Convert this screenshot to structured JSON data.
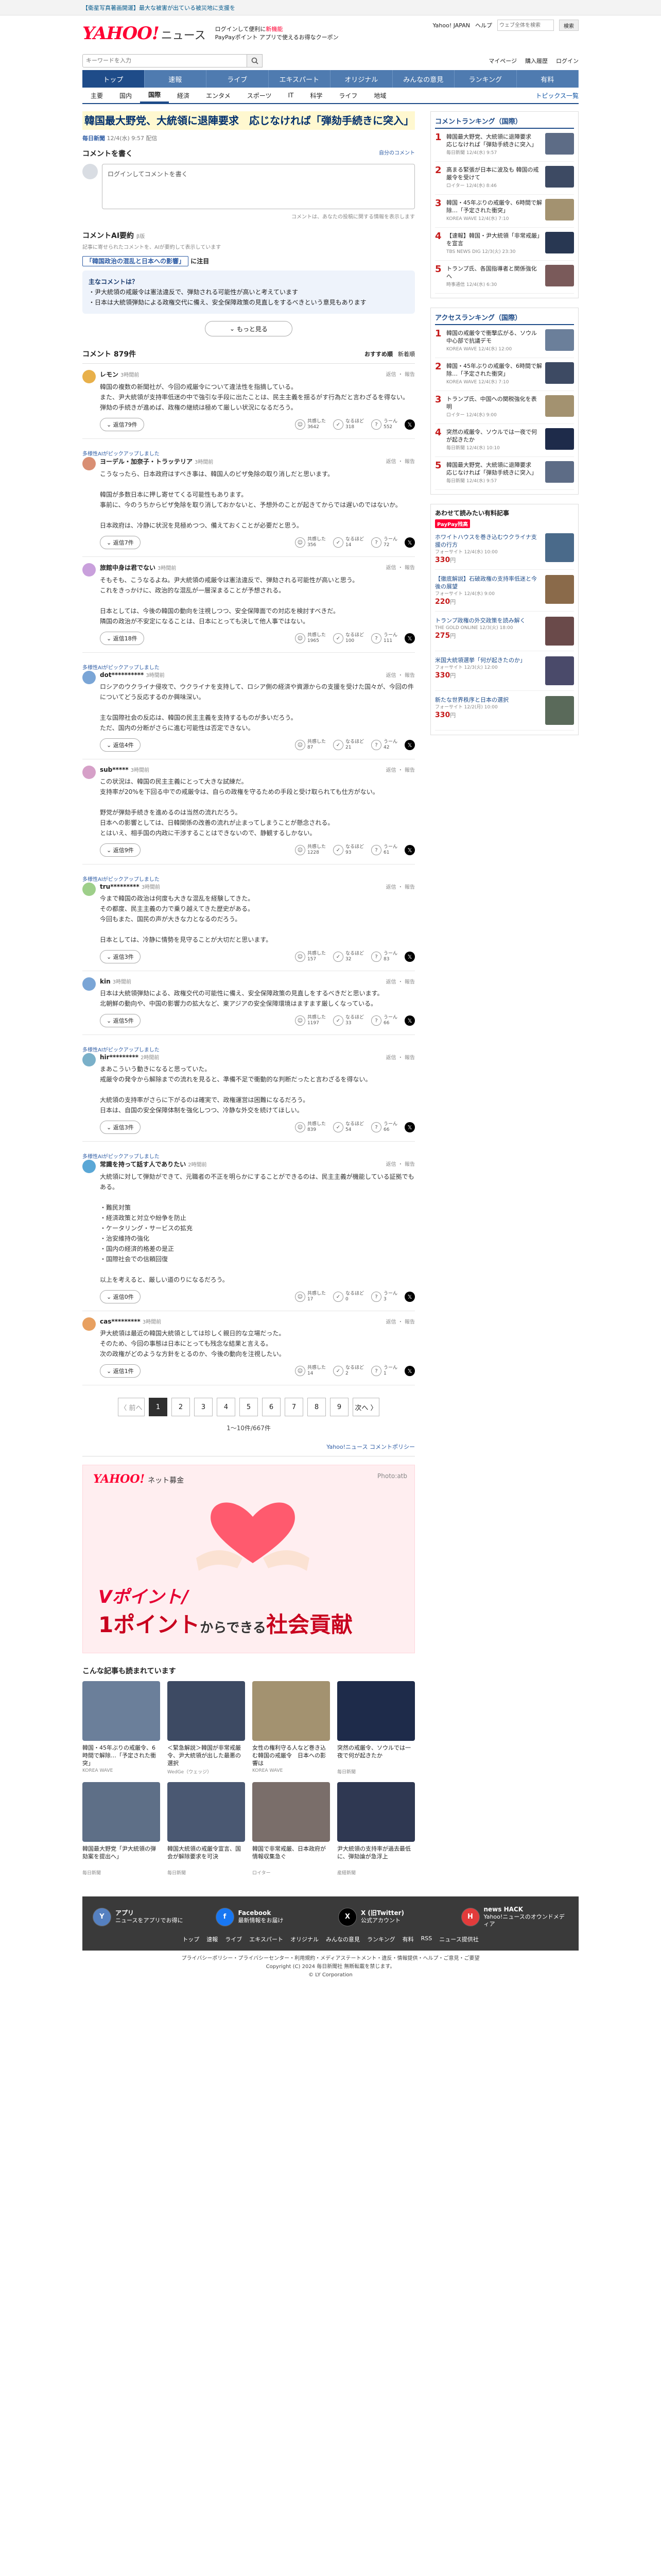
{
  "topnotice": {
    "tag": "【衛星写真著画開運】最大な被害が出ている被災地に支援を",
    "right": "Yahoo! JAPAN"
  },
  "masthead": {
    "brand": "YAHOO!",
    "brand_sub": "ニュース",
    "promo1": "ログインして便利に",
    "promo1_red": "新機能",
    "promo2": "PayPayポイント",
    "promo2b": "アプリで使えるお得なクーポン",
    "links": [
      "Yahoo! JAPAN",
      "ヘルプ"
    ],
    "search_placeholder": "ウェブ全体を検索",
    "search_button": "検索"
  },
  "searchbar": {
    "placeholder": "キーワードを入力",
    "links": [
      "マイページ",
      "購入履歴",
      "ログイン"
    ]
  },
  "gnav": [
    "トップ",
    "速報",
    "ライブ",
    "エキスパート",
    "オリジナル",
    "みんなの意見",
    "ランキング",
    "有料"
  ],
  "subnav": {
    "items": [
      "主要",
      "国内",
      "国際",
      "経済",
      "エンタメ",
      "スポーツ",
      "IT",
      "科学",
      "ライフ",
      "地域"
    ],
    "right": "トピックス一覧"
  },
  "article": {
    "title": "韓国最大野党、大統領に退陣要求　応じなければ「弾劾手続きに突入」",
    "source": "毎日新聞",
    "time": "12/4(水) 9:57 配信"
  },
  "write": {
    "heading": "コメントを書く",
    "right": "自分のコメント",
    "placeholder": "ログインしてコメントを書く",
    "note": "コメントは、あなたの投稿に関する情報を表示します"
  },
  "ai": {
    "heading": "コメントAI要約",
    "badge": "β版",
    "desc": "記事に寄せられたコメントを、AIが要約して表示しています",
    "topic_prefix": "「韓国政治の混乱と日本への影響」",
    "topic_suffix": "に注目",
    "box_head": "主なコメントは？",
    "points": [
      "尹大統領の戒厳令は憲法違反で、弾劾される可能性が高いと考えています",
      "日本は大統領弾劾による政権交代に備え、安全保障政策の見直しをするべきという意見もあります"
    ],
    "more": "もっと見る"
  },
  "comments": {
    "heading": "コメント",
    "count": "879件",
    "sort": [
      "おすすめ順",
      "新着順"
    ],
    "ai_pick": "多様性AIがピックアップしました",
    "reply_label": "返信",
    "report_label": "報告",
    "vote_labels": [
      "共感した",
      "なるほど",
      "うーん"
    ],
    "list": [
      {
        "name": "レモン",
        "time": "3時間前",
        "text": "韓国の複数の新聞社が、今回の戒厳令について違法性を指摘している。\nまた、尹大統領が支持率低迷の中で強引な手段に出たことは、民主主義を揺るがす行為だと言わざるを得ない。\n弾劾の手続きが進めば、政権の継続は極めて厳しい状況になるだろう。",
        "replies": "返信79件",
        "v": [
          "3642",
          "318",
          "552"
        ],
        "color": "#e8b04a",
        "ai": false
      },
      {
        "name": "ヨーデル・加奈子・トラッテリア",
        "time": "3時間前",
        "text": "こうなったら、日本政府はすべき事は、韓国人のビザ免除の取り消しだと思います。\n\n韓国が多数日本に押し寄せてくる可能性もあります。\n事前に、今のうちからビザ免除を取り消しておかないと、予想外のことが起きてからでは遅いのではないか。\n\n日本政府は、冷静に状況を見極めつつ、備えておくことが必要だと思う。",
        "replies": "返信7件",
        "v": [
          "356",
          "14",
          "72"
        ],
        "color": "#d98f74",
        "ai": true
      },
      {
        "name": "旅館中身は君でない",
        "time": "3時間前",
        "text": "そもそも、こうなるよね。尹大統領の戒厳令は憲法違反で、弾劾される可能性が高いと思う。\nこれをきっかけに、政治的な混乱が一層深まることが予想される。\n\n日本としては、今後の韓国の動向を注視しつつ、安全保障面での対応を検討すべきだ。\n隣国の政治が不安定になることは、日本にとっても決して他人事ではない。",
        "replies": "返信18件",
        "v": [
          "1965",
          "100",
          "111"
        ],
        "color": "#c9a0dc",
        "ai": false
      },
      {
        "name": "dot**********",
        "time": "3時間前",
        "text": "ロシアのウクライナ侵攻で、ウクライナを支持して、ロシア側の経済や資源からの支援を受けた国々が、今回の件についてどう反応するのか興味深い。\n\n主な国際社会の反応は、韓国の民主主義を支持するものが多いだろう。\nただ、国内の分断がさらに進む可能性は否定できない。",
        "replies": "返信4件",
        "v": [
          "87",
          "21",
          "42"
        ],
        "color": "#7aa5d6",
        "ai": true
      },
      {
        "name": "sub*****",
        "time": "3時間前",
        "text": "この状況は、韓国の民主主義にとって大きな試練だ。\n支持率が20%を下回る中での戒厳令は、自らの政権を守るための手段と受け取られても仕方がない。\n\n野党が弾劾手続きを進めるのは当然の流れだろう。\n日本への影響としては、日韓関係の改善の流れが止まってしまうことが懸念される。\nとはいえ、相手国の内政に干渉することはできないので、静観するしかない。",
        "replies": "返信9件",
        "v": [
          "1228",
          "93",
          "61"
        ],
        "color": "#d6a0c8",
        "ai": false
      },
      {
        "name": "tru*********",
        "time": "3時間前",
        "text": "今まで韓国の政治は何度も大きな混乱を経験してきた。\nその都度、民主主義の力で乗り越えてきた歴史がある。\n今回もまた、国民の声が大きな力となるのだろう。\n\n日本としては、冷静に情勢を見守ることが大切だと思います。",
        "replies": "返信3件",
        "v": [
          "157",
          "32",
          "83"
        ],
        "color": "#9ecf8a",
        "ai": true
      },
      {
        "name": "kin",
        "time": "3時間前",
        "text": "日本は大統領弾劾による、政権交代の可能性に備え、安全保障政策の見直しをするべきだと思います。\n北朝鮮の動向や、中国の影響力の拡大など、東アジアの安全保障環境はますます厳しくなっている。",
        "replies": "返信5件",
        "v": [
          "1197",
          "33",
          "66"
        ],
        "color": "#7aa5d6",
        "ai": false
      },
      {
        "name": "hir*********",
        "time": "2時間前",
        "text": "まあこういう動きになると思っていた。\n戒厳令の発令から解除までの流れを見ると、準備不足で衝動的な判断だったと言わざるを得ない。\n\n大統領の支持率がさらに下がるのは確実で、政権運営は困難になるだろう。\n日本は、自国の安全保障体制を強化しつつ、冷静な外交を続けてほしい。",
        "replies": "返信3件",
        "v": [
          "839",
          "54",
          "66"
        ],
        "color": "#7ab0c9",
        "ai": true
      },
      {
        "name": "常識を持って話す人でありたい",
        "time": "2時間前",
        "text": "大統領に対して弾劾ができて、元職者の不正を明らかにすることができるのは、民主主義が機能している証拠でもある。\n\n・難民対策\n・経済政策と対立や紛争を防止\n・ケータリング・サービスの拡充\n・治安維持の強化\n・国内の経済的格差の是正\n・国際社会での信頼回復\n\n以上を考えると、厳しい道のりになるだろう。",
        "replies": "返信0件",
        "v": [
          "17",
          "0",
          "3"
        ],
        "color": "#5aa7d6",
        "ai": true
      },
      {
        "name": "cas*********",
        "time": "3時間前",
        "text": "尹大統領は最近の韓国大統領としては珍しく親日的な立場だった。\nそのため、今回の事態は日本にとっても残念な結果と言える。\n次の政権がどのような方針をとるのか、今後の動向を注視したい。",
        "replies": "返信1件",
        "v": [
          "14",
          "2",
          "1"
        ],
        "color": "#e8a060",
        "ai": false
      }
    ]
  },
  "pager": {
    "prev": "〈 前へ",
    "next": "次へ 〉",
    "pages": [
      "1",
      "2",
      "3",
      "4",
      "5",
      "6",
      "7",
      "8",
      "9"
    ],
    "info": "1〜10件/667件",
    "link": "Yahoo!ニュース コメントポリシー"
  },
  "banner": {
    "brand": "YAHOO!",
    "brand_sub": "ネット募金",
    "right": "Photo:atb",
    "line1": "Vポイント/",
    "line2a": "1ポイント",
    "line2b": "からできる",
    "line2c": "社会貢献"
  },
  "related": {
    "heading": "こんな記事も読まれています",
    "cards": [
      {
        "t": "韓国・45年ぶりの戒厳令、6時間で解除…「予定された衝突」",
        "s": "KOREA WAVE",
        "c": "#6b7f9a"
      },
      {
        "t": "＜緊急解説＞韓国が非常戒厳令、尹大統領が出した最悪の選択",
        "s": "WedGe（ウェッジ）",
        "c": "#3d4a63"
      },
      {
        "t": "女性の権利守る人など巻き込む韓国の戒厳令　日本への影響は",
        "s": "KOREA WAVE",
        "c": "#a39270"
      },
      {
        "t": "突然の戒厳令、ソウルでは一夜で何が起きたか",
        "s": "毎日新聞",
        "c": "#1e2b4a"
      },
      {
        "t": "韓国最大野党「尹大統領の弾劾案を提出へ」",
        "s": "毎日新聞",
        "c": "#5e6f87"
      },
      {
        "t": "韓国大統領の戒厳令宣言、国会が解除要求を可決",
        "s": "毎日新聞",
        "c": "#4a5872"
      },
      {
        "t": "韓国で非常戒厳、日本政府が情報収集急ぐ",
        "s": "ロイター",
        "c": "#7a6e6a"
      },
      {
        "t": "尹大統領の支持率が過去最低に、弾劾論が急浮上",
        "s": "産経新聞",
        "c": "#2f3852"
      }
    ]
  },
  "side": {
    "rank_head": "コメントランキング（国際）",
    "ranks": [
      {
        "n": "1",
        "t": "韓国最大野党、大統領に退陣要求　応じなければ「弾劾手続きに突入」",
        "m": "毎日新聞 12/4(水) 9:57",
        "c": "#5d6c86"
      },
      {
        "n": "2",
        "t": "高まる緊張が日本に波及も 韓国の戒厳令を受けて",
        "m": "ロイター 12/4(水) 8:46",
        "c": "#3d4a63"
      },
      {
        "n": "3",
        "t": "韓国・45年ぶりの戒厳令、6時間で解除…「予定された衝突」",
        "m": "KOREA WAVE 12/4(水) 7:10",
        "c": "#a39270"
      },
      {
        "n": "4",
        "t": "【速報】韓国・尹大統領「非常戒厳」を宣言",
        "m": "TBS NEWS DIG 12/3(火) 23:30",
        "c": "#283752"
      },
      {
        "n": "5",
        "t": "トランプ氏、各国指導者と関係強化へ",
        "m": "時事通信 12/4(水) 6:30",
        "c": "#7a5a5a"
      }
    ],
    "access_head": "アクセスランキング（国際）",
    "access": [
      {
        "n": "1",
        "t": "韓国の戒厳令で衝撃広がる、ソウル中心部で抗議デモ",
        "m": "KOREA WAVE 12/4(水) 12:00",
        "c": "#6b7f9a"
      },
      {
        "n": "2",
        "t": "韓国・45年ぶりの戒厳令、6時間で解除…「予定された衝突」",
        "m": "KOREA WAVE 12/4(水) 7:10",
        "c": "#3d4a63"
      },
      {
        "n": "3",
        "t": "トランプ氏、中国への関税強化を表明",
        "m": "ロイター 12/4(水) 9:00",
        "c": "#a39270"
      },
      {
        "n": "4",
        "t": "突然の戒厳令、ソウルでは一夜で何が起きたか",
        "m": "毎日新聞 12/4(水) 10:10",
        "c": "#1e2b4a"
      },
      {
        "n": "5",
        "t": "韓国最大野党、大統領に退陣要求　応じなければ「弾劾手続きに突入」",
        "m": "毎日新聞 12/4(水) 9:57",
        "c": "#5d6c86"
      }
    ],
    "ads_head": "あわせて読みたい有料記事",
    "ads_pp": "PayPay残高",
    "ads": [
      {
        "t": "ホワイトハウスを巻き込むウクライナ支援の行方",
        "m": "フォーサイト 12/4(水) 10:00",
        "p": "330",
        "c": "#4a6a8a"
      },
      {
        "t": "【徹底解説】石破政権の支持率低迷と今後の展望",
        "m": "フォーサイト 12/4(水) 9:00",
        "p": "220",
        "c": "#8a6a4a"
      },
      {
        "t": "トランプ政権の外交政策を読み解く",
        "m": "THE GOLD ONLINE 12/3(火) 18:00",
        "p": "275",
        "c": "#6a4a4a"
      },
      {
        "t": "米国大統領選挙「何が起きたのか」",
        "m": "フォーサイト 12/3(火) 12:00",
        "p": "330",
        "c": "#4a4a6a"
      },
      {
        "t": "新たな世界秩序と日本の選択",
        "m": "フォーサイト 12/2(月) 10:00",
        "p": "330",
        "c": "#5a6a5a"
      }
    ],
    "price_unit": "円"
  },
  "footer": {
    "items": [
      {
        "b": "アプリ",
        "t": "ニュースをアプリでお得に",
        "c": "#5580c0",
        "i": "Y"
      },
      {
        "b": "Facebook",
        "t": "最新情報をお届け",
        "c": "#1877f2",
        "i": "f"
      },
      {
        "b": "X (旧Twitter)",
        "t": "公式アカウント",
        "c": "#000000",
        "i": "X"
      },
      {
        "b": "news HACK",
        "t": "Yahoo!ニュースのオウンドメディア",
        "c": "#e23b3b",
        "i": "H"
      }
    ],
    "nav": [
      "トップ",
      "速報",
      "ライブ",
      "エキスパート",
      "オリジナル",
      "みんなの意見",
      "ランキング",
      "有料",
      "RSS",
      "ニュース提供社"
    ],
    "legal1": "プライバシーポリシー・プライバシーセンター・利用規約・メディアステートメント・違反・情報提供・ヘルプ・ご意見・ご要望",
    "legal2": "Copyright (C) 2024 毎日新聞社 無断転載を禁じます。",
    "legal3": "© LY Corporation"
  }
}
